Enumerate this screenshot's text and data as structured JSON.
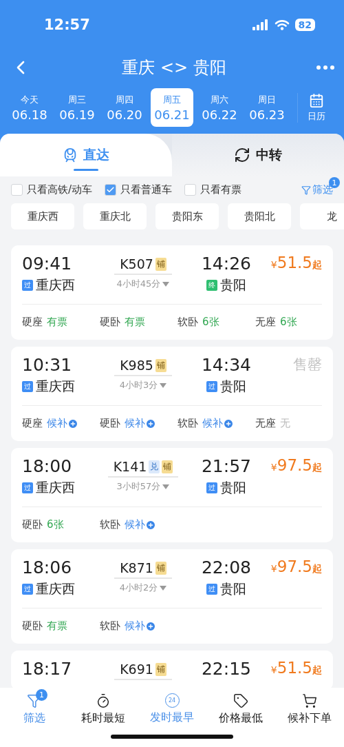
{
  "status_bar": {
    "time": "12:57",
    "battery": "82"
  },
  "header": {
    "title": "重庆 <> 贵阳"
  },
  "dates": [
    {
      "day": "今天",
      "date": "06.18",
      "selected": false
    },
    {
      "day": "周三",
      "date": "06.19",
      "selected": false
    },
    {
      "day": "周四",
      "date": "06.20",
      "selected": false
    },
    {
      "day": "周五",
      "date": "06.21",
      "selected": true
    },
    {
      "day": "周六",
      "date": "06.22",
      "selected": false
    },
    {
      "day": "周日",
      "date": "06.23",
      "selected": false
    }
  ],
  "calendar": {
    "label": "日历"
  },
  "tabs": [
    {
      "label": "直达",
      "kind": "direct",
      "selected": true
    },
    {
      "label": "中转",
      "kind": "transfer",
      "selected": false
    }
  ],
  "filters": [
    {
      "label": "只看高铁/动车",
      "checked": false
    },
    {
      "label": "只看普通车",
      "checked": true
    },
    {
      "label": "只看有票",
      "checked": false
    }
  ],
  "filter_button": {
    "label": "筛选",
    "badge": "1"
  },
  "stations": [
    "重庆西",
    "重庆北",
    "贵阳东",
    "贵阳北",
    "龙"
  ],
  "trains": [
    {
      "depart": "09:41",
      "from_tag": {
        "label": "过",
        "kind": "pass"
      },
      "from": "重庆西",
      "number": "K507",
      "badges": [
        {
          "label": "铺",
          "kind": "berth"
        }
      ],
      "duration": "4小时45分",
      "arrive": "14:26",
      "to_tag": {
        "label": "终",
        "kind": "terminal"
      },
      "to": "贵阳",
      "currency": "¥",
      "price": "51.5",
      "suffix": "起",
      "seats": [
        {
          "type": "硬座",
          "status": "有票",
          "kind": "available"
        },
        {
          "type": "硬卧",
          "status": "有票",
          "kind": "available"
        },
        {
          "type": "软卧",
          "status": "6张",
          "kind": "available"
        },
        {
          "type": "无座",
          "status": "6张",
          "kind": "available"
        }
      ]
    },
    {
      "depart": "10:31",
      "from_tag": {
        "label": "过",
        "kind": "pass"
      },
      "from": "重庆西",
      "number": "K985",
      "badges": [
        {
          "label": "铺",
          "kind": "berth"
        }
      ],
      "duration": "4小时3分",
      "arrive": "14:34",
      "to_tag": {
        "label": "过",
        "kind": "pass"
      },
      "to": "贵阳",
      "sold_out": "售罄",
      "seats": [
        {
          "type": "硬座",
          "status": "候补",
          "kind": "waitlist"
        },
        {
          "type": "硬卧",
          "status": "候补",
          "kind": "waitlist"
        },
        {
          "type": "软卧",
          "status": "候补",
          "kind": "waitlist"
        },
        {
          "type": "无座",
          "status": "无",
          "kind": "none"
        }
      ]
    },
    {
      "depart": "18:00",
      "from_tag": {
        "label": "过",
        "kind": "pass"
      },
      "from": "重庆西",
      "number": "K141",
      "badges": [
        {
          "label": "兑",
          "kind": "redeem"
        },
        {
          "label": "铺",
          "kind": "berth"
        }
      ],
      "duration": "3小时57分",
      "arrive": "21:57",
      "to_tag": {
        "label": "过",
        "kind": "pass"
      },
      "to": "贵阳",
      "currency": "¥",
      "price": "97.5",
      "suffix": "起",
      "seats": [
        {
          "type": "硬卧",
          "status": "6张",
          "kind": "available"
        },
        {
          "type": "软卧",
          "status": "候补",
          "kind": "waitlist"
        }
      ]
    },
    {
      "depart": "18:06",
      "from_tag": {
        "label": "过",
        "kind": "pass"
      },
      "from": "重庆西",
      "number": "K871",
      "badges": [
        {
          "label": "铺",
          "kind": "berth"
        }
      ],
      "duration": "4小时2分",
      "arrive": "22:08",
      "to_tag": {
        "label": "过",
        "kind": "pass"
      },
      "to": "贵阳",
      "currency": "¥",
      "price": "97.5",
      "suffix": "起",
      "seats": [
        {
          "type": "硬卧",
          "status": "有票",
          "kind": "available"
        },
        {
          "type": "软卧",
          "status": "候补",
          "kind": "waitlist"
        }
      ]
    },
    {
      "depart": "18:17",
      "number": "K691",
      "badges": [
        {
          "label": "铺",
          "kind": "berth"
        }
      ],
      "arrive": "22:15",
      "currency": "¥",
      "price": "51.5",
      "suffix": "起"
    }
  ],
  "bottom_nav": [
    {
      "label": "筛选",
      "kind": "filter",
      "active": true,
      "badge": "1"
    },
    {
      "label": "耗时最短",
      "kind": "timer",
      "active": false
    },
    {
      "label": "发时最早",
      "kind": "clock",
      "active": true,
      "icon_text": "24"
    },
    {
      "label": "价格最低",
      "kind": "tag",
      "active": false
    },
    {
      "label": "候补下单",
      "kind": "cart",
      "active": false
    }
  ]
}
